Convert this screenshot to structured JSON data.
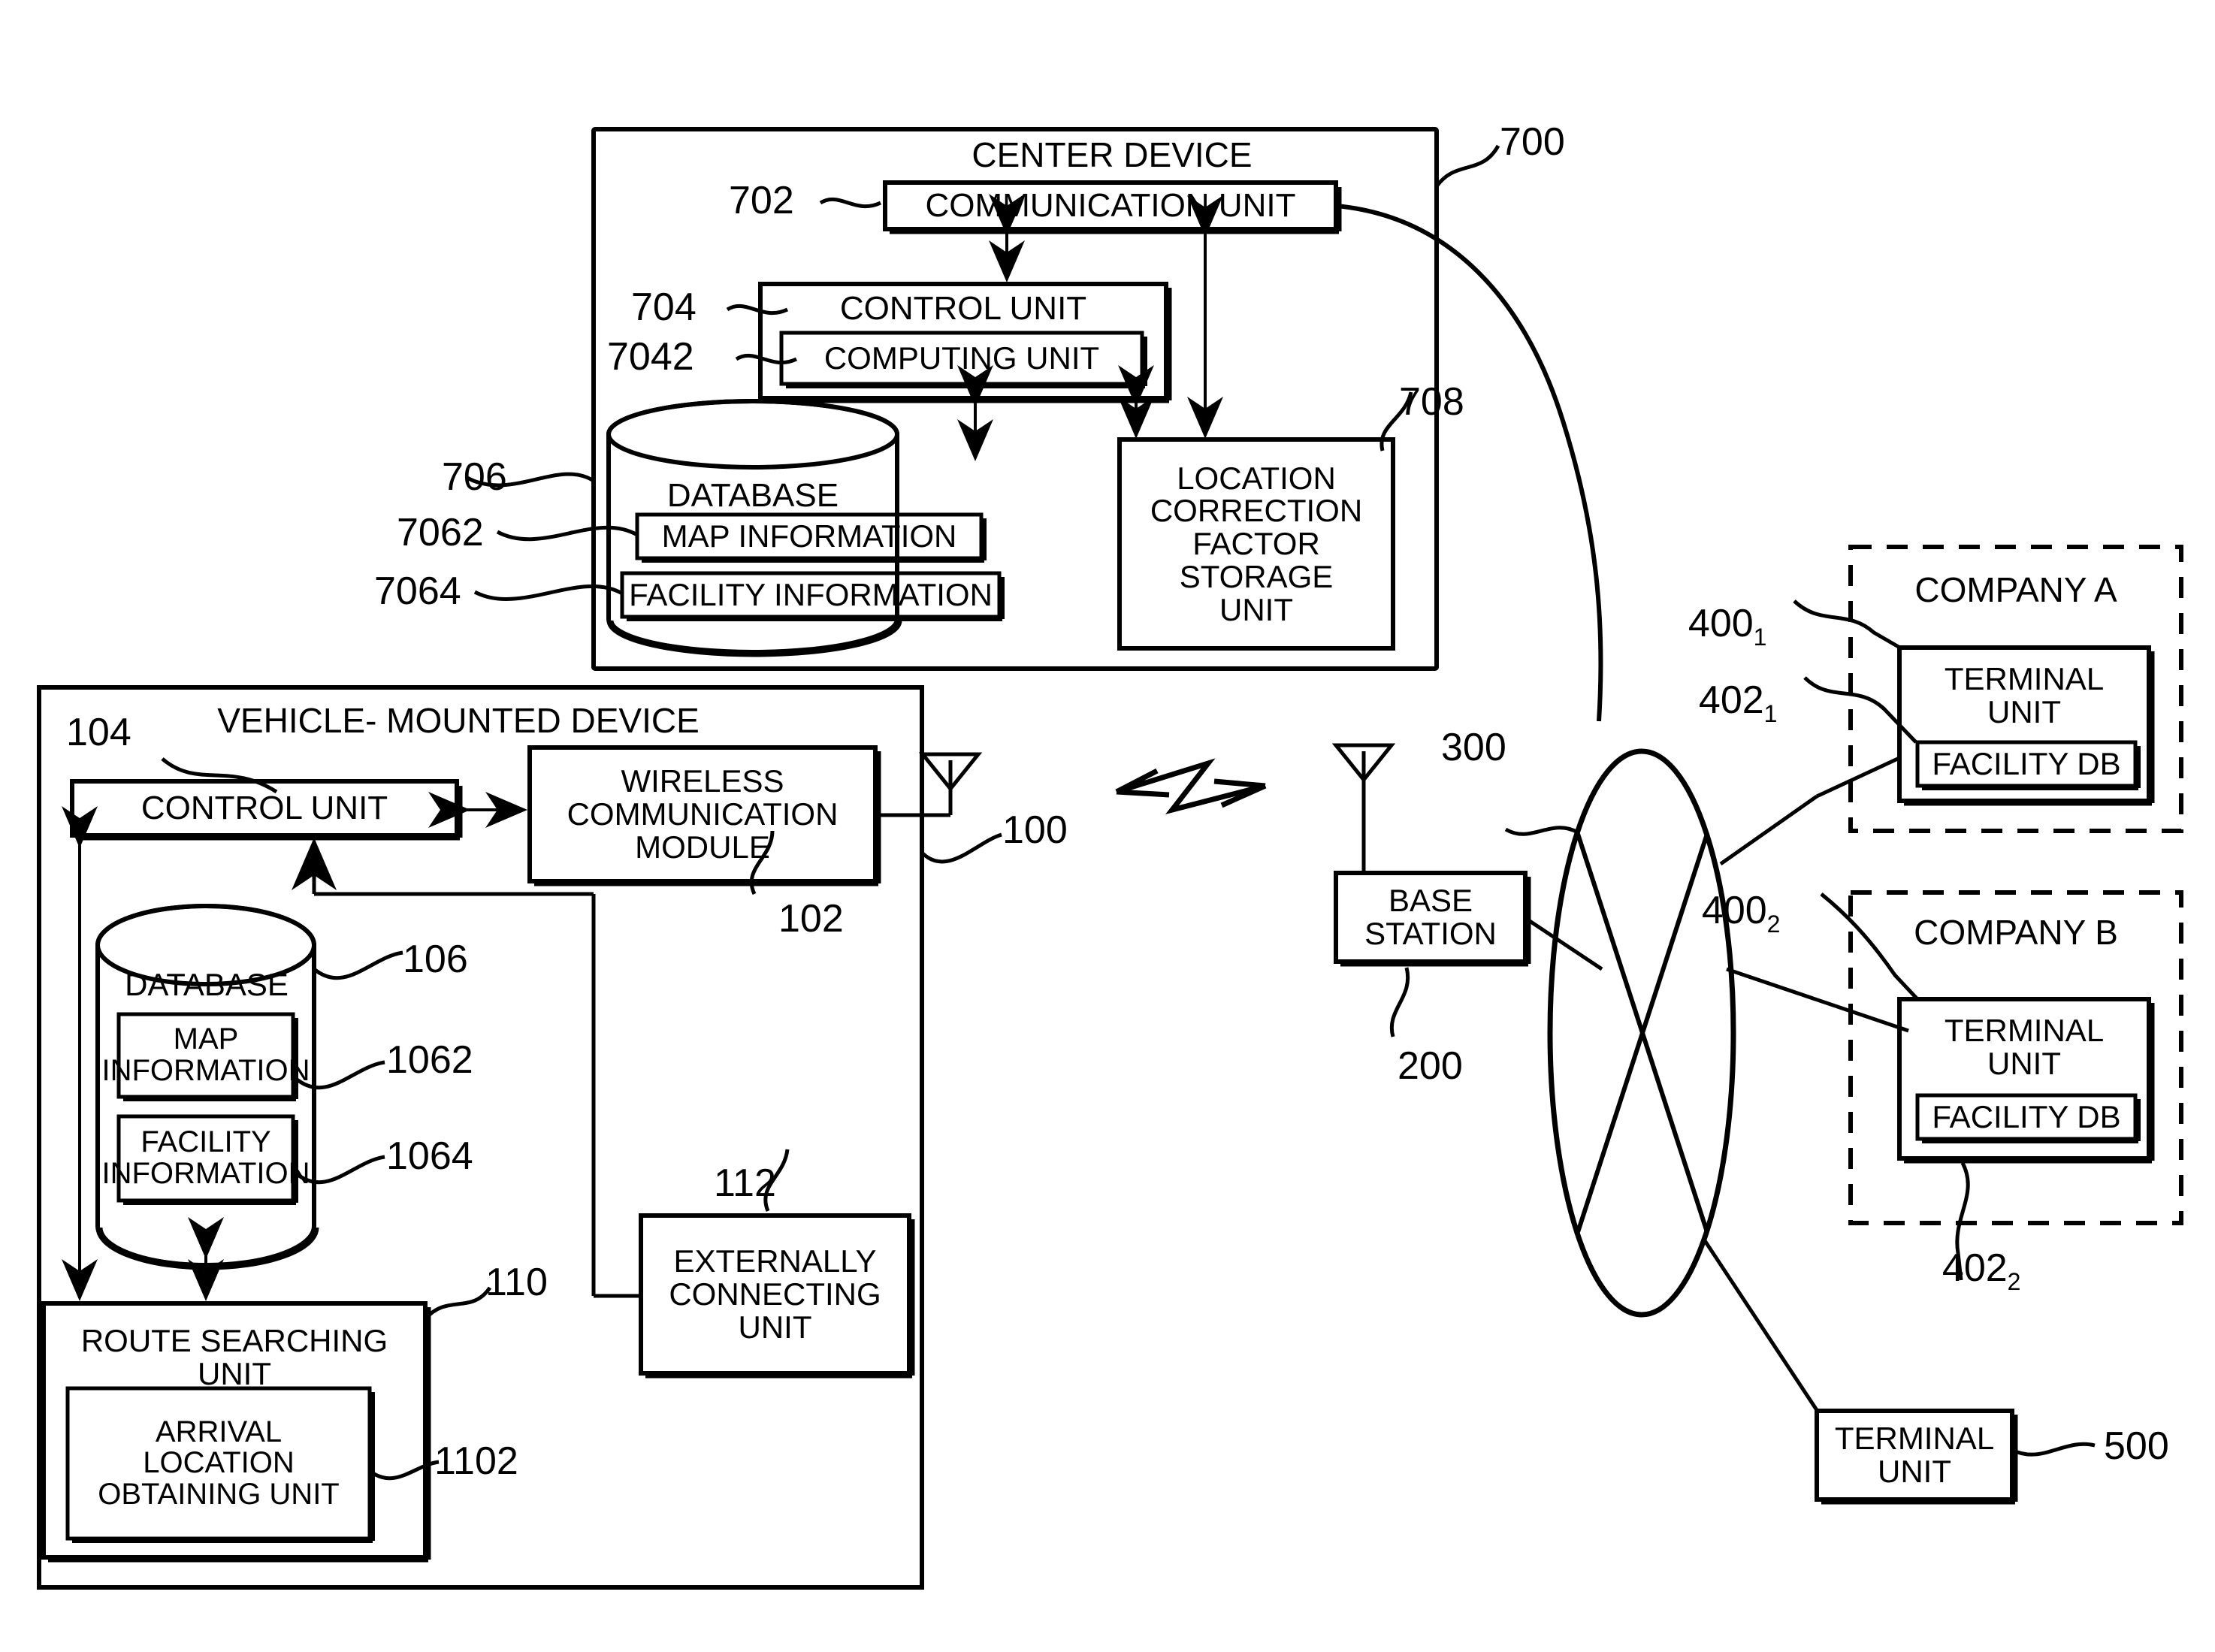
{
  "figure": {
    "domain": "patent-block-diagram",
    "stroke_color": "#000000",
    "background_color": "#ffffff"
  },
  "center_device": {
    "title": "CENTER DEVICE",
    "ref": "700",
    "communication_unit": {
      "label": "COMMUNICATION UNIT",
      "ref": "702"
    },
    "control_unit": {
      "label": "CONTROL UNIT",
      "ref": "704"
    },
    "computing_unit": {
      "label": "COMPUTING UNIT",
      "ref": "7042"
    },
    "database": {
      "label": "DATABASE",
      "ref": "706"
    },
    "map_information": {
      "label": "MAP INFORMATION",
      "ref": "7062"
    },
    "facility_information": {
      "label": "FACILITY INFORMATION",
      "ref": "7064"
    },
    "location_correction": {
      "label": "LOCATION\nCORRECTION\nFACTOR\nSTORAGE\nUNIT",
      "ref": "708"
    }
  },
  "vehicle_device": {
    "title": "VEHICLE- MOUNTED DEVICE",
    "ref": "100",
    "control_unit": {
      "label": "CONTROL UNIT",
      "ref": "104"
    },
    "wireless_module": {
      "label": "WIRELESS\nCOMMUNICATION\nMODULE",
      "ref": "102"
    },
    "database": {
      "label": "DATABASE",
      "ref": "106"
    },
    "map_information": {
      "label": "MAP\nINFORMATION",
      "ref": "1062"
    },
    "facility_information": {
      "label": "FACILITY\nINFORMATION",
      "ref": "1064"
    },
    "route_searching_unit": {
      "label": "ROUTE SEARCHING\nUNIT",
      "ref": "110"
    },
    "arrival_location_unit": {
      "label": "ARRIVAL\nLOCATION\nOBTAINING UNIT",
      "ref": "1102"
    },
    "externally_connecting_unit": {
      "label": "EXTERNALLY\nCONNECTING\nUNIT",
      "ref": "112"
    }
  },
  "network": {
    "base_station": {
      "label": "BASE\nSTATION",
      "ref": "200"
    },
    "cloud": {
      "ref": "300"
    }
  },
  "company_a": {
    "title": "COMPANY A",
    "ref": "400",
    "ref_sub": "1",
    "terminal_unit": {
      "label": "TERMINAL\nUNIT",
      "ref": "402",
      "ref_sub": "1"
    },
    "facility_db": {
      "label": "FACILITY DB"
    }
  },
  "company_b": {
    "title": "COMPANY B",
    "ref": "400",
    "ref_sub": "2",
    "terminal_unit": {
      "label": "TERMINAL\nUNIT",
      "ref": "402",
      "ref_sub": "2"
    },
    "facility_db": {
      "label": "FACILITY DB"
    }
  },
  "standalone_terminal": {
    "label": "TERMINAL\nUNIT",
    "ref": "500"
  },
  "icons": {
    "antenna_vehicle": "antenna-icon",
    "antenna_base": "antenna-icon",
    "wireless_link": "wireless-signal-icon"
  }
}
